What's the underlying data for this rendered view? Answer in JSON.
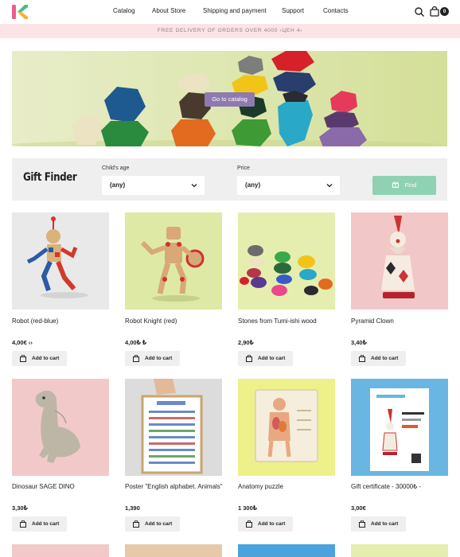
{
  "header": {
    "logo": "K",
    "nav": [
      "Catalog",
      "About Store",
      "Shipping and payment",
      "Support",
      "Contacts"
    ],
    "icons": [
      "search-icon",
      "cart-icon"
    ],
    "cart_count": "0"
  },
  "promo": {
    "text": "FREE DELIVERY OF ORDERS OVER 4000 ‹ЦЕН 4›"
  },
  "hero": {
    "cta": "Go to catalog"
  },
  "gift_finder": {
    "title": "Gift Finder",
    "age_label": "Child's age",
    "age_value": "(any)",
    "price_label": "Price",
    "price_value": "(any)",
    "button": "Find"
  },
  "products": [
    {
      "name": "Robot (red-blue)",
      "price": "4,00€ ‹›",
      "button": "Add to cart"
    },
    {
      "name": "Robot Knight (red)",
      "price": "4,00₺ ₺",
      "button": "Add to cart"
    },
    {
      "name": "Stones from Tumi-ishi wood",
      "price": "2,90₺",
      "button": "Add to cart"
    },
    {
      "name": "Pyramid Clown",
      "price": "3,40₺",
      "button": "Add to cart"
    },
    {
      "name": "Dinosaur SAGE DINO",
      "price": "3,30₺",
      "button": "Add to cart"
    },
    {
      "name": "Poster \"English alphabet. Animals\"",
      "price": "1,390",
      "button": "Add to cart"
    },
    {
      "name": "Anatomy puzzle",
      "price": "1 300₺",
      "button": "Add to cart"
    },
    {
      "name": "Gift certificate - 30000₺ -",
      "price": "3,00€",
      "button": "Add to cart"
    }
  ],
  "colors": {
    "promo_bg": "#fbe3e6",
    "hero_button": "#8e7ab0",
    "find_button": "#8fd2b3",
    "finder_bg": "#efefef",
    "logo_green": "#3ebf8a",
    "logo_pink": "#ef5b8a"
  }
}
